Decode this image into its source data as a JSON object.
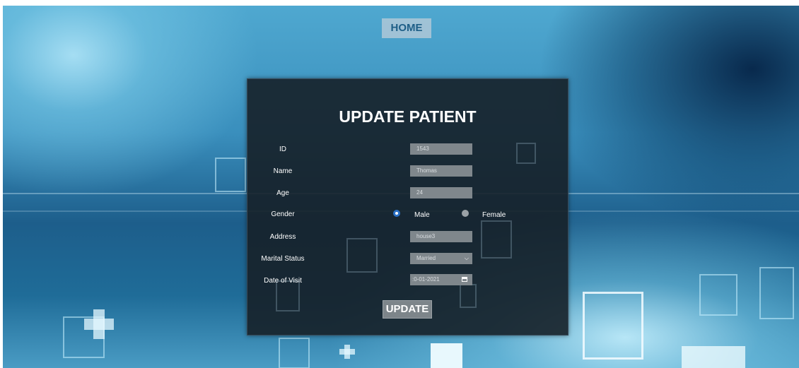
{
  "nav": {
    "home_label": "HOME"
  },
  "form": {
    "title": "UPDATE PATIENT",
    "fields": {
      "id": {
        "label": "ID",
        "value": "1543"
      },
      "name": {
        "label": "Name",
        "value": "Thomas"
      },
      "age": {
        "label": "Age",
        "value": "24"
      },
      "gender": {
        "label": "Gender",
        "options": [
          "Male",
          "Female"
        ],
        "selected": "Male"
      },
      "address": {
        "label": "Address",
        "value": "house3"
      },
      "marital_status": {
        "label": "Marital Status",
        "value": "Married"
      },
      "date_of_visit": {
        "label": "Date of Visit",
        "value": ":0-01-2021"
      }
    },
    "submit_label": "UPDATE"
  },
  "colors": {
    "radio_checked": "#2a6fc4",
    "panel_background": "#162028",
    "field_background": "#7f878c",
    "home_text": "#1e5f87"
  },
  "icons": {
    "select_arrow": "chevron-down-icon",
    "date_picker": "calendar-icon"
  }
}
